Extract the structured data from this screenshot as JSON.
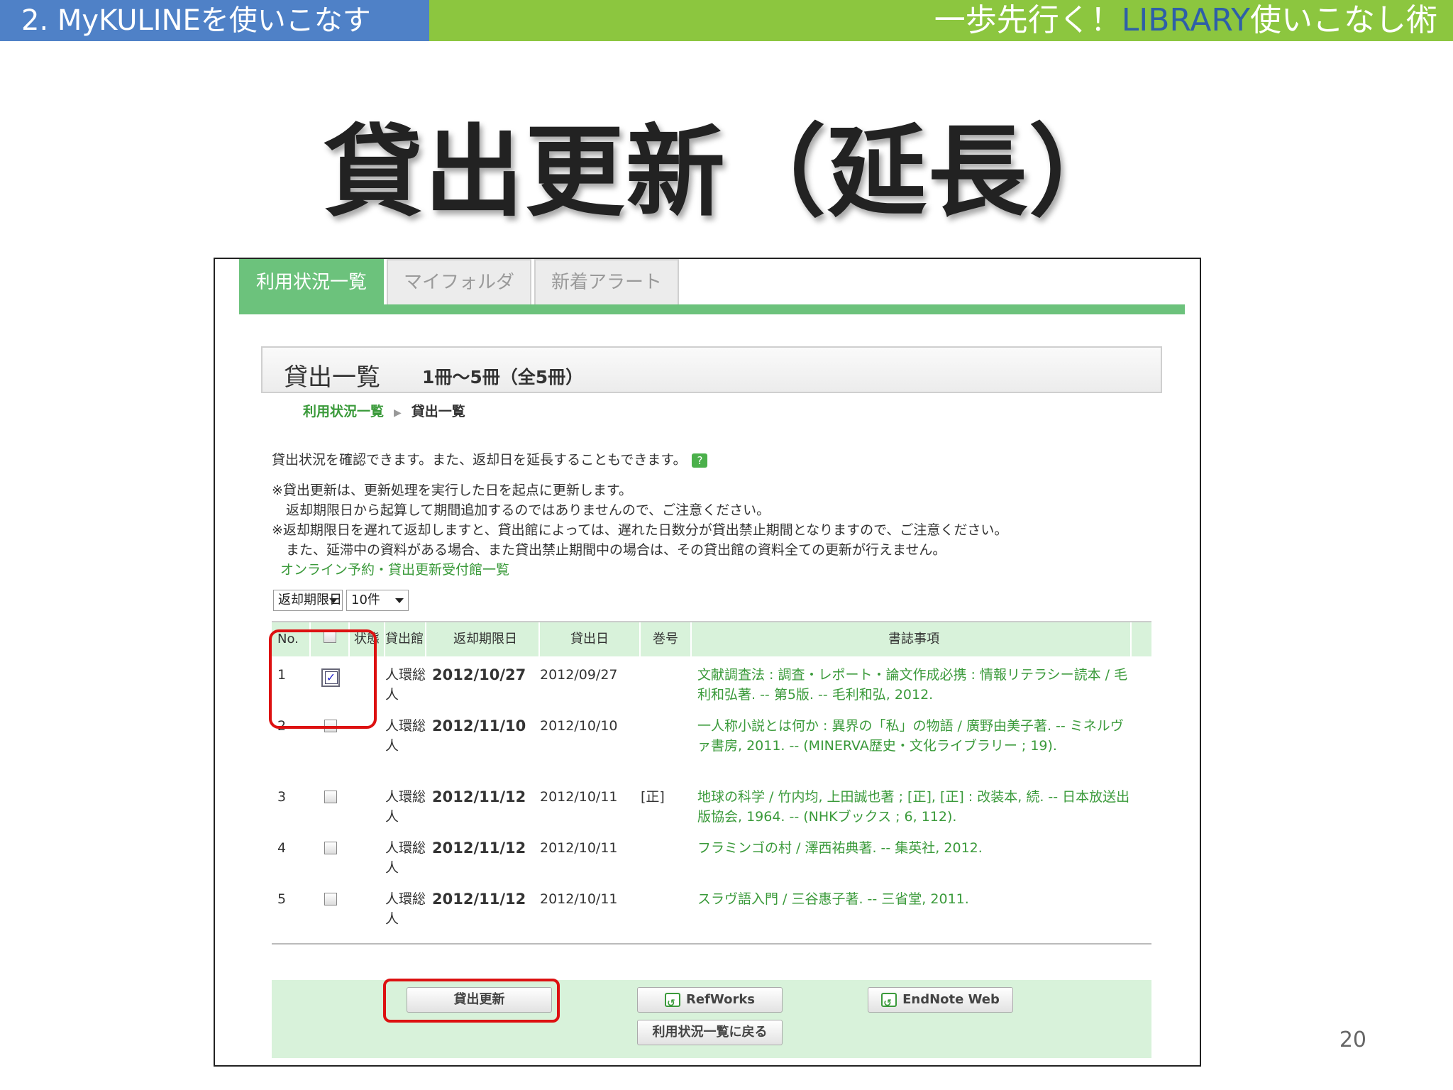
{
  "header": {
    "left_label": "2. MyKULINEを使いこなす",
    "right_prefix": "一歩先行く！",
    "right_accent": "LIBRARY",
    "right_suffix": "使いこなし術"
  },
  "slide_title": "貸出更新（延長）",
  "page_number": "20",
  "screenshot": {
    "tabs": [
      "利用状況一覧",
      "マイフォルダ",
      "新着アラート"
    ],
    "list_title": "貸出一覧",
    "list_count": "1冊〜5冊（全5冊）",
    "breadcrumb": {
      "link": "利用状況一覧",
      "current": "貸出一覧"
    },
    "intro": "貸出状況を確認できます。また、返却日を延長することもできます。",
    "help_label": "?",
    "notes": [
      "※貸出更新は、更新処理を実行した日を起点に更新します。",
      "返却期限日から起算して期間追加するのではありませんので、ご注意ください。",
      "※返却期限日を遅れて返却しますと、貸出館によっては、遅れた日数分が貸出禁止期間となりますので、ご注意ください。",
      "また、延滞中の資料がある場合、また貸出禁止期間中の場合は、その貸出館の資料全ての更新が行えません。"
    ],
    "notes_link": "オンライン予約・貸出更新受付館一覧",
    "sort_select": "返却期限日",
    "count_select": "10件",
    "columns": {
      "no": "No.",
      "status": "状態",
      "library": "貸出館",
      "due": "返却期限日",
      "loan": "貸出日",
      "volume": "巻号",
      "bib": "書誌事項"
    },
    "rows": [
      {
        "no": "1",
        "checked": true,
        "library": "人環総人",
        "due": "2012/10/27",
        "loan": "2012/09/27",
        "volume": "",
        "bib": "文献調査法 : 調査・レポート・論文作成必携 : 情報リテラシー読本 / 毛利和弘著. -- 第5版. -- 毛利和弘, 2012."
      },
      {
        "no": "2",
        "checked": false,
        "library": "人環総人",
        "due": "2012/11/10",
        "loan": "2012/10/10",
        "volume": "",
        "bib": "一人称小説とは何か : 異界の「私」の物語 / 廣野由美子著. -- ミネルヴァ書房, 2011. -- (MINERVA歴史・文化ライブラリー ; 19)."
      },
      {
        "no": "3",
        "checked": false,
        "library": "人環総人",
        "due": "2012/11/12",
        "loan": "2012/10/11",
        "volume": "[正]",
        "bib": "地球の科学 / 竹内均, 上田誠也著 ; [正], [正] : 改装本, 続. -- 日本放送出版協会, 1964. -- (NHKブックス ; 6, 112)."
      },
      {
        "no": "4",
        "checked": false,
        "library": "人環総人",
        "due": "2012/11/12",
        "loan": "2012/10/11",
        "volume": "",
        "bib": "フラミンゴの村 / 澤西祐典著. -- 集英社, 2012."
      },
      {
        "no": "5",
        "checked": false,
        "library": "人環総人",
        "due": "2012/11/12",
        "loan": "2012/10/11",
        "volume": "",
        "bib": "スラヴ語入門 / 三谷惠子著. -- 三省堂, 2011."
      }
    ],
    "buttons": {
      "renew": "貸出更新",
      "refworks": "RefWorks",
      "endnote": "EndNote Web",
      "back": "利用状況一覧に戻る"
    }
  }
}
